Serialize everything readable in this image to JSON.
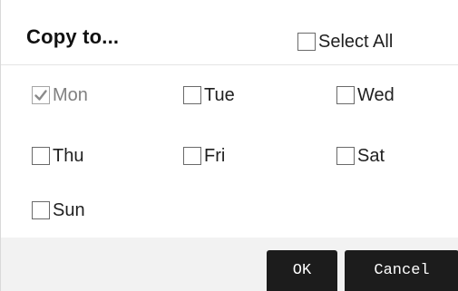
{
  "dialog": {
    "title": "Copy to...",
    "select_all": {
      "label": "Select All",
      "checked": false
    },
    "days": [
      {
        "label": "Mon",
        "checked": true,
        "disabled": true
      },
      {
        "label": "Tue",
        "checked": false,
        "disabled": false
      },
      {
        "label": "Wed",
        "checked": false,
        "disabled": false
      },
      {
        "label": "Thu",
        "checked": false,
        "disabled": false
      },
      {
        "label": "Fri",
        "checked": false,
        "disabled": false
      },
      {
        "label": "Sat",
        "checked": false,
        "disabled": false
      },
      {
        "label": "Sun",
        "checked": false,
        "disabled": false
      }
    ],
    "buttons": {
      "ok_label": "OK",
      "cancel_label": "Cancel"
    }
  }
}
